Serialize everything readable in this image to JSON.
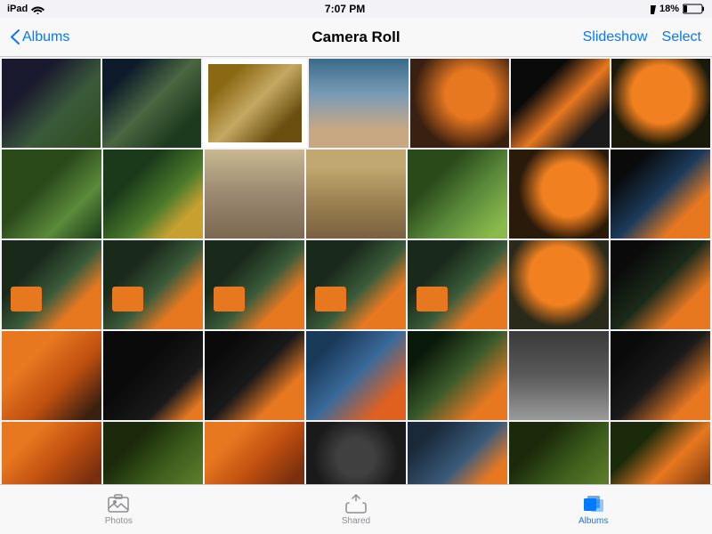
{
  "statusBar": {
    "carrier": "iPad",
    "time": "7:07 PM",
    "battery": "18%",
    "signal": "wifi"
  },
  "navBar": {
    "backLabel": "Albums",
    "title": "Camera Roll",
    "slideshowLabel": "Slideshow",
    "selectLabel": "Select"
  },
  "tabBar": {
    "tabs": [
      {
        "id": "photos",
        "label": "Photos",
        "active": false
      },
      {
        "id": "shared",
        "label": "Shared",
        "active": false
      },
      {
        "id": "albums",
        "label": "Albums",
        "active": true
      }
    ]
  },
  "grid": {
    "rows": 5,
    "cols": 7
  }
}
